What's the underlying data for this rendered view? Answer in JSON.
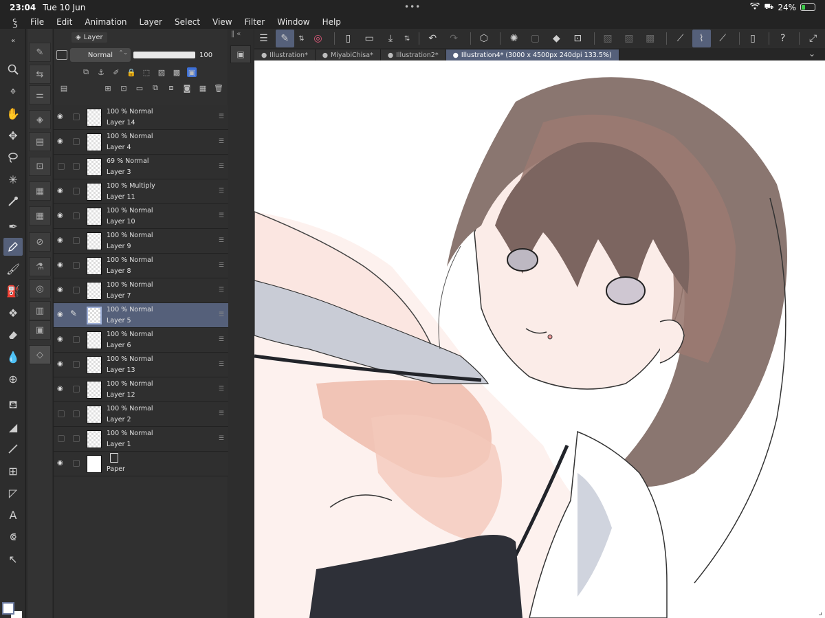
{
  "status": {
    "time": "23:04",
    "date": "Tue 10 Jun",
    "battery": "24%",
    "battery_level": 0.24
  },
  "menu": [
    "File",
    "Edit",
    "Animation",
    "Layer",
    "Select",
    "View",
    "Filter",
    "Window",
    "Help"
  ],
  "layer_panel": {
    "tab_label": "Layer",
    "blend_mode": "Normal",
    "opacity": "100",
    "opacity_level": 1.0,
    "layers": [
      {
        "mode": "100 % Normal",
        "name": "Layer 14",
        "visible": true
      },
      {
        "mode": "100 % Normal",
        "name": "Layer 4",
        "visible": true
      },
      {
        "mode": "69 % Normal",
        "name": "Layer 3",
        "visible": false
      },
      {
        "mode": "100 % Multiply",
        "name": "Layer 11",
        "visible": true
      },
      {
        "mode": "100 % Normal",
        "name": "Layer 10",
        "visible": true
      },
      {
        "mode": "100 % Normal",
        "name": "Layer 9",
        "visible": true
      },
      {
        "mode": "100 % Normal",
        "name": "Layer 8",
        "visible": true
      },
      {
        "mode": "100 % Normal",
        "name": "Layer 7",
        "visible": true
      },
      {
        "mode": "100 % Normal",
        "name": "Layer 5",
        "visible": true,
        "selected": true
      },
      {
        "mode": "100 % Normal",
        "name": "Layer 6",
        "visible": true
      },
      {
        "mode": "100 % Normal",
        "name": "Layer 13",
        "visible": true
      },
      {
        "mode": "100 % Normal",
        "name": "Layer 12",
        "visible": true
      },
      {
        "mode": "100 % Normal",
        "name": "Layer 2",
        "visible": false
      },
      {
        "mode": "100 % Normal",
        "name": "Layer 1",
        "visible": false
      },
      {
        "mode": "",
        "name": "Paper",
        "visible": true,
        "paper": true
      }
    ]
  },
  "tabs": [
    {
      "label": "Illustration*",
      "active": false
    },
    {
      "label": "MiyabiChisa*",
      "active": false
    },
    {
      "label": "Illustration2*",
      "active": false
    },
    {
      "label": "Illustration4* (3000 x 4500px 240dpi 133.5%)",
      "active": true
    }
  ],
  "colors": {
    "accent": "#55607a",
    "panel": "#303030",
    "canvas": "#ffffff"
  }
}
